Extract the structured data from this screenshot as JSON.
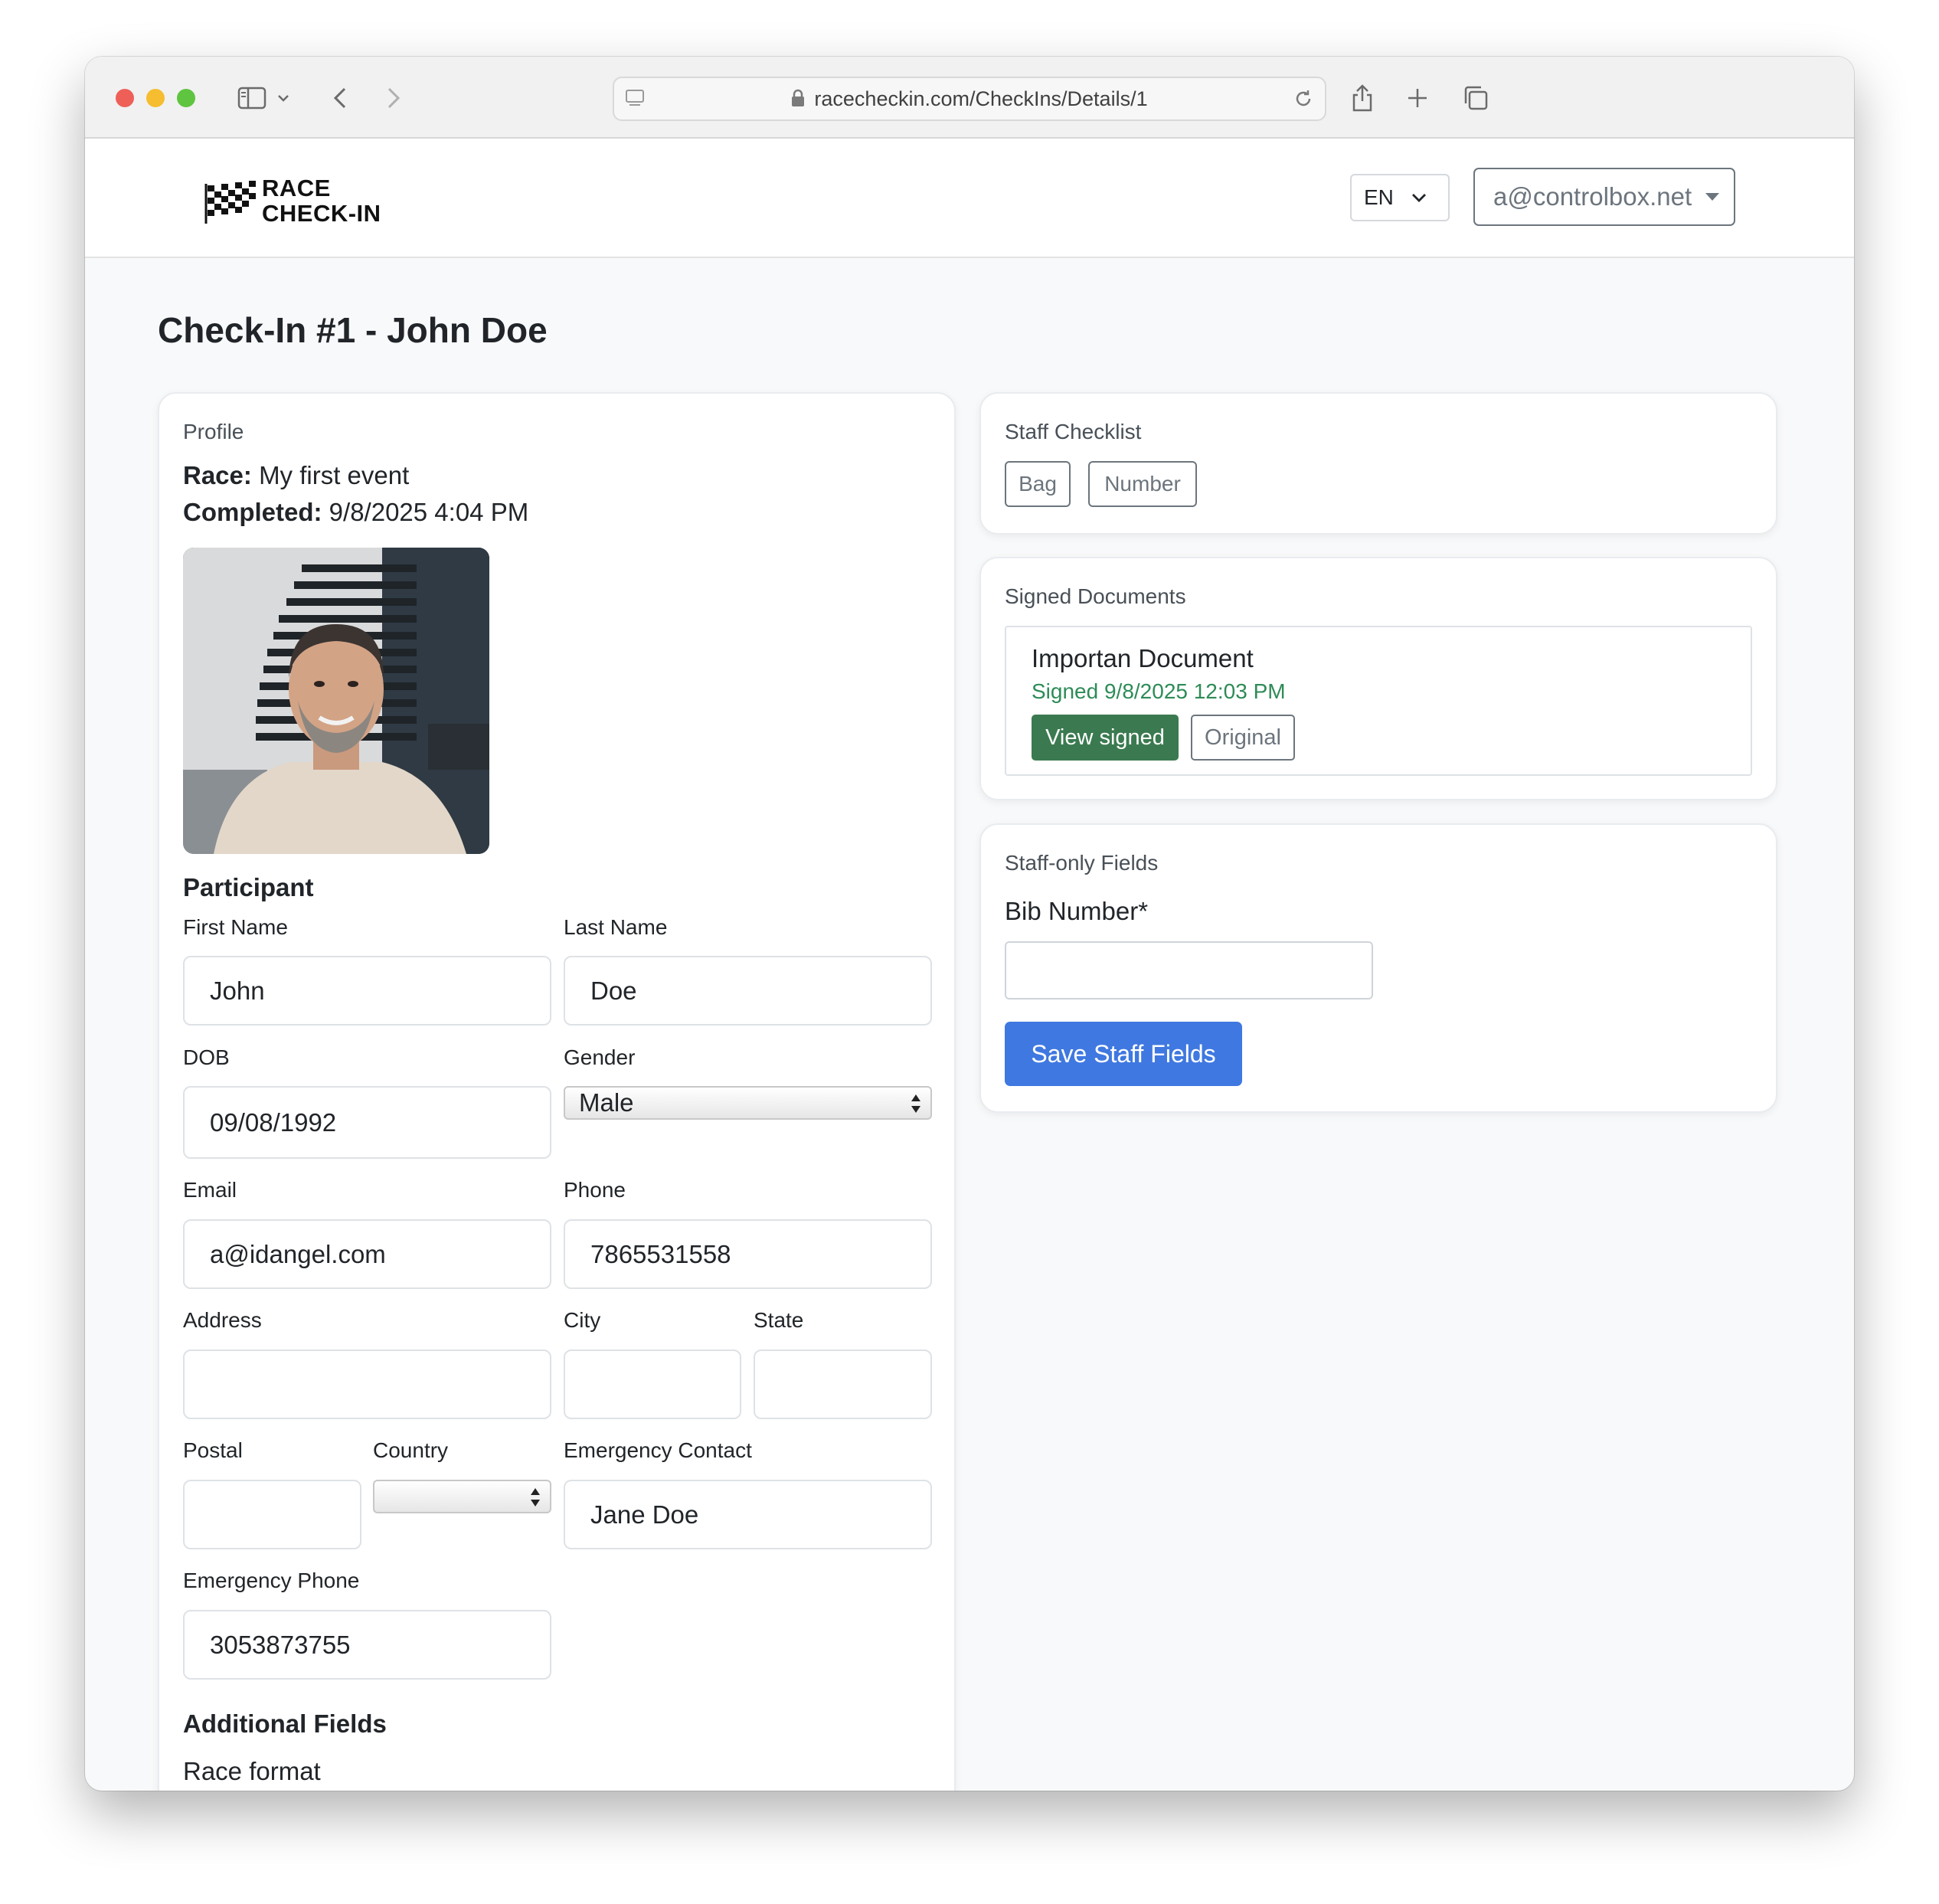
{
  "browser": {
    "url": "racecheckin.com/CheckIns/Details/1"
  },
  "navbar": {
    "logo_line1": "RACE",
    "logo_line2": "CHECK-IN",
    "language": "EN",
    "user_email": "a@controlbox.net"
  },
  "page": {
    "title": "Check-In #1 - John Doe"
  },
  "profile": {
    "card_label": "Profile",
    "race_label": "Race:",
    "race_value": "My first event",
    "completed_label": "Completed:",
    "completed_value": "9/8/2025 4:04 PM",
    "participant_heading": "Participant",
    "fields": {
      "first_name": {
        "label": "First Name",
        "value": "John"
      },
      "last_name": {
        "label": "Last Name",
        "value": "Doe"
      },
      "dob": {
        "label": "DOB",
        "value": "09/08/1992"
      },
      "gender": {
        "label": "Gender",
        "value": "Male"
      },
      "email": {
        "label": "Email",
        "value": "a@idangel.com"
      },
      "phone": {
        "label": "Phone",
        "value": "7865531558"
      },
      "address": {
        "label": "Address",
        "value": ""
      },
      "city": {
        "label": "City",
        "value": ""
      },
      "state": {
        "label": "State",
        "value": ""
      },
      "postal": {
        "label": "Postal",
        "value": ""
      },
      "country": {
        "label": "Country",
        "value": ""
      },
      "emergency_contact": {
        "label": "Emergency Contact",
        "value": "Jane Doe"
      },
      "emergency_phone": {
        "label": "Emergency Phone",
        "value": "3053873755"
      }
    },
    "additional_heading": "Additional Fields",
    "race_format_label": "Race format"
  },
  "staff_checklist": {
    "card_label": "Staff Checklist",
    "items": [
      "Bag",
      "Number"
    ]
  },
  "signed_documents": {
    "card_label": "Signed Documents",
    "documents": [
      {
        "title": "Importan Document",
        "status": "Signed 9/8/2025 12:03 PM",
        "view_label": "View signed",
        "original_label": "Original"
      }
    ]
  },
  "staff_fields": {
    "card_label": "Staff-only Fields",
    "bib_label": "Bib Number*",
    "bib_value": "",
    "save_label": "Save Staff Fields"
  },
  "colors": {
    "primary": "#3f78e0",
    "success": "#3b7a50",
    "success_text": "#2e8b57",
    "secondary": "#6c757d"
  }
}
